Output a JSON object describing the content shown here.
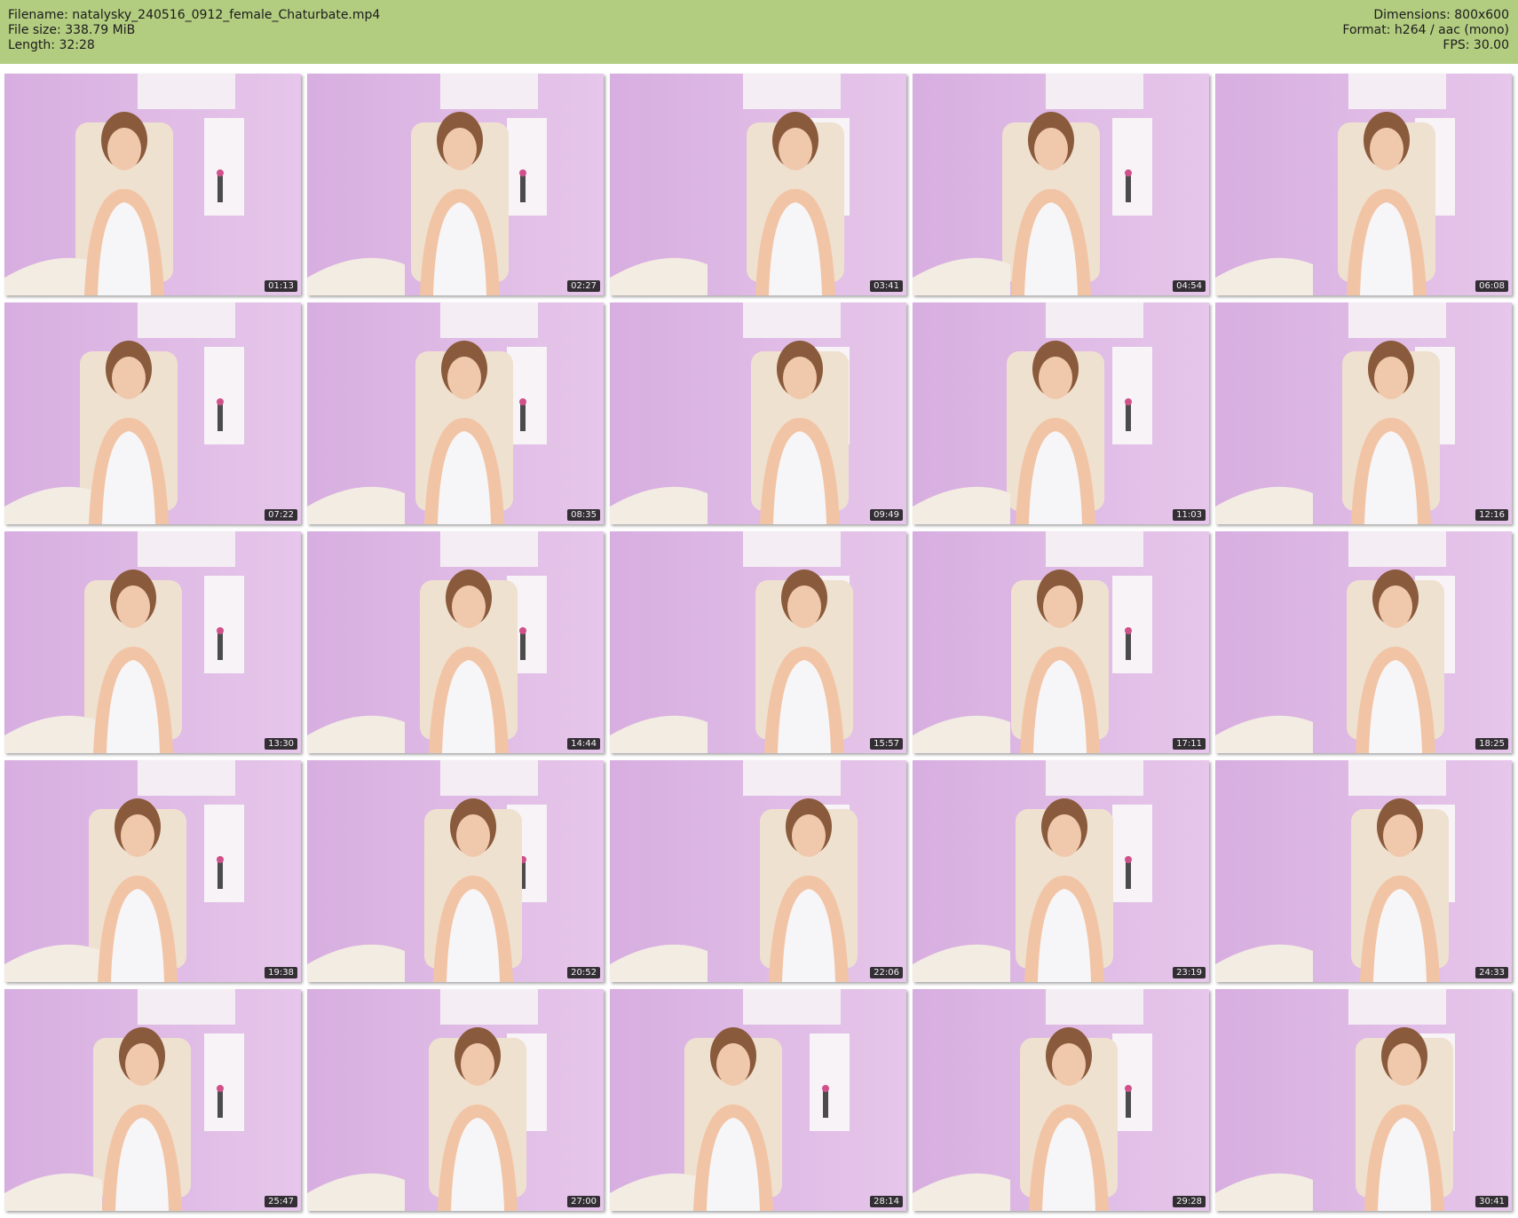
{
  "header": {
    "filename_label": "Filename: natalysky_240516_0912_female_Chaturbate.mp4",
    "filesize_label": "File size: 338.79 MiB",
    "length_label": "Length: 32:28",
    "dimensions_label": "Dimensions: 800x600",
    "format_label": "Format: h264 / aac (mono)",
    "fps_label": "FPS: 30.00",
    "background_color": "#b2cc80"
  },
  "thumbnails": [
    {
      "timestamp": "01:13"
    },
    {
      "timestamp": "02:27"
    },
    {
      "timestamp": "03:41"
    },
    {
      "timestamp": "04:54"
    },
    {
      "timestamp": "06:08"
    },
    {
      "timestamp": "07:22"
    },
    {
      "timestamp": "08:35"
    },
    {
      "timestamp": "09:49"
    },
    {
      "timestamp": "11:03"
    },
    {
      "timestamp": "12:16"
    },
    {
      "timestamp": "13:30"
    },
    {
      "timestamp": "14:44"
    },
    {
      "timestamp": "15:57"
    },
    {
      "timestamp": "17:11"
    },
    {
      "timestamp": "18:25"
    },
    {
      "timestamp": "19:38"
    },
    {
      "timestamp": "20:52"
    },
    {
      "timestamp": "22:06"
    },
    {
      "timestamp": "23:19"
    },
    {
      "timestamp": "24:33"
    },
    {
      "timestamp": "25:47"
    },
    {
      "timestamp": "27:00"
    },
    {
      "timestamp": "28:14"
    },
    {
      "timestamp": "29:28"
    },
    {
      "timestamp": "30:41"
    }
  ]
}
